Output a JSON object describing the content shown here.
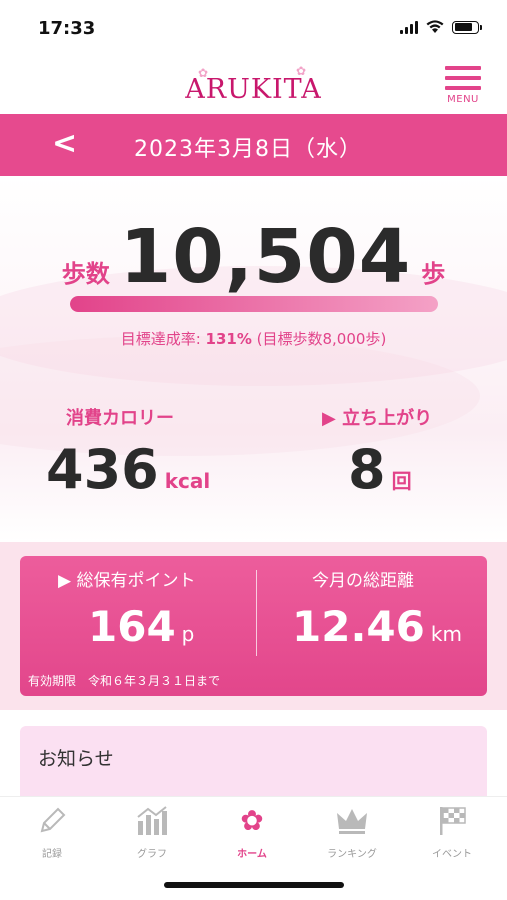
{
  "status_bar": {
    "time": "17:33"
  },
  "header": {
    "logo": "ARUKITA",
    "menu_label": "MENU"
  },
  "date_bar": {
    "back_icon": "<",
    "date": "2023年3月8日（水）"
  },
  "steps": {
    "label": "歩数",
    "value": "10,504",
    "unit": "歩",
    "progress_fraction": 1.0,
    "goal_prefix": "目標達成率: ",
    "goal_rate": "131%",
    "goal_suffix": " (目標歩数8,000歩)"
  },
  "calories": {
    "label": "消費カロリー",
    "value": "436",
    "unit": "kcal"
  },
  "stand_ups": {
    "label": "▶ 立ち上がり",
    "value": "8",
    "unit": "回"
  },
  "points": {
    "title": "▶ 総保有ポイント",
    "value": "164",
    "unit": "p",
    "expiry_label": "有効期限",
    "expiry_value": "令和６年３月３１日まで"
  },
  "distance": {
    "title": "今月の総距離",
    "value": "12.46",
    "unit": "km"
  },
  "notice": {
    "title": "お知らせ"
  },
  "tabs": [
    {
      "label": "記録",
      "icon": "pencil-icon"
    },
    {
      "label": "グラフ",
      "icon": "chart-icon"
    },
    {
      "label": "ホーム",
      "icon": "sakura-icon"
    },
    {
      "label": "ランキング",
      "icon": "crown-icon"
    },
    {
      "label": "イベント",
      "icon": "flag-icon"
    }
  ],
  "colors": {
    "accent": "#e2438a",
    "date_bar": "#e64a8e",
    "notice_bg": "#fbe0f2"
  }
}
